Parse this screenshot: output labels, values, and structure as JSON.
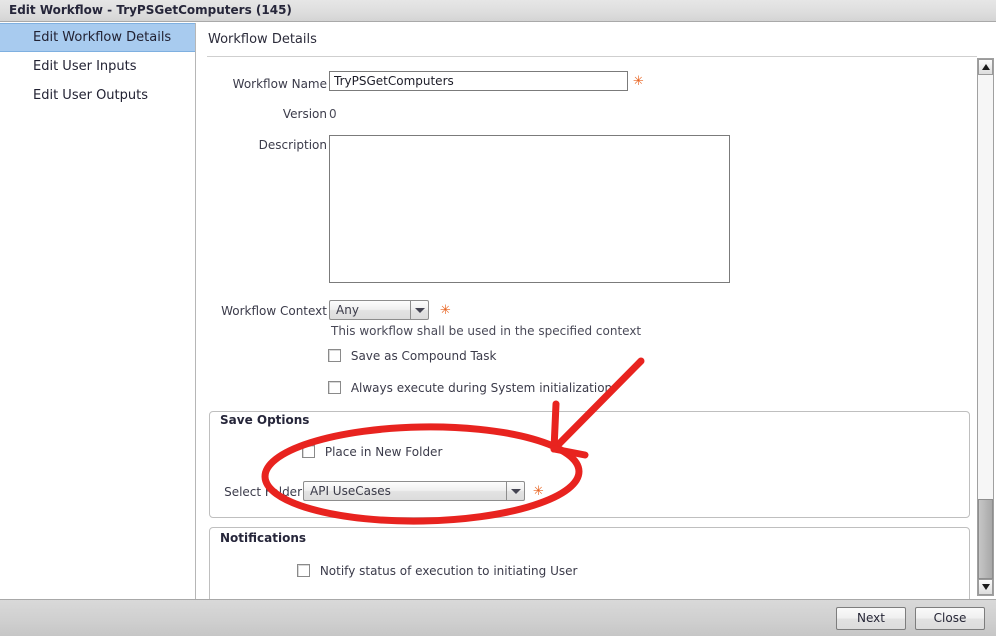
{
  "window": {
    "title": "Edit Workflow - TryPSGetComputers (145)"
  },
  "sidebar": {
    "items": [
      {
        "label": "Edit Workflow Details",
        "selected": true
      },
      {
        "label": "Edit User Inputs",
        "selected": false
      },
      {
        "label": "Edit User Outputs",
        "selected": false
      }
    ]
  },
  "main": {
    "panel_title": "Workflow Details",
    "fields": {
      "workflow_name_label": "Workflow Name",
      "workflow_name_value": "TryPSGetComputers",
      "workflow_name_required": "✳",
      "version_label": "Version",
      "version_value": "0",
      "description_label": "Description",
      "description_value": "",
      "description_placeholder": "",
      "workflow_context_label": "Workflow Context",
      "workflow_context_value": "Any",
      "workflow_context_required": "✳",
      "workflow_context_hint": "This workflow shall be used in the specified context",
      "save_compound_task_label": "Save as Compound Task",
      "always_execute_label": "Always execute during System initialization"
    },
    "save_options": {
      "title": "Save Options",
      "place_in_new_folder_label": "Place in New Folder",
      "select_folder_label": "Select Folder",
      "select_folder_value": "API UseCases",
      "select_folder_required": "✳"
    },
    "notifications": {
      "title": "Notifications",
      "notify_status_label": "Notify status of execution to initiating User"
    }
  },
  "footer": {
    "next_label": "Next",
    "close_label": "Close"
  },
  "annotation": {
    "color": "#e8231f"
  }
}
